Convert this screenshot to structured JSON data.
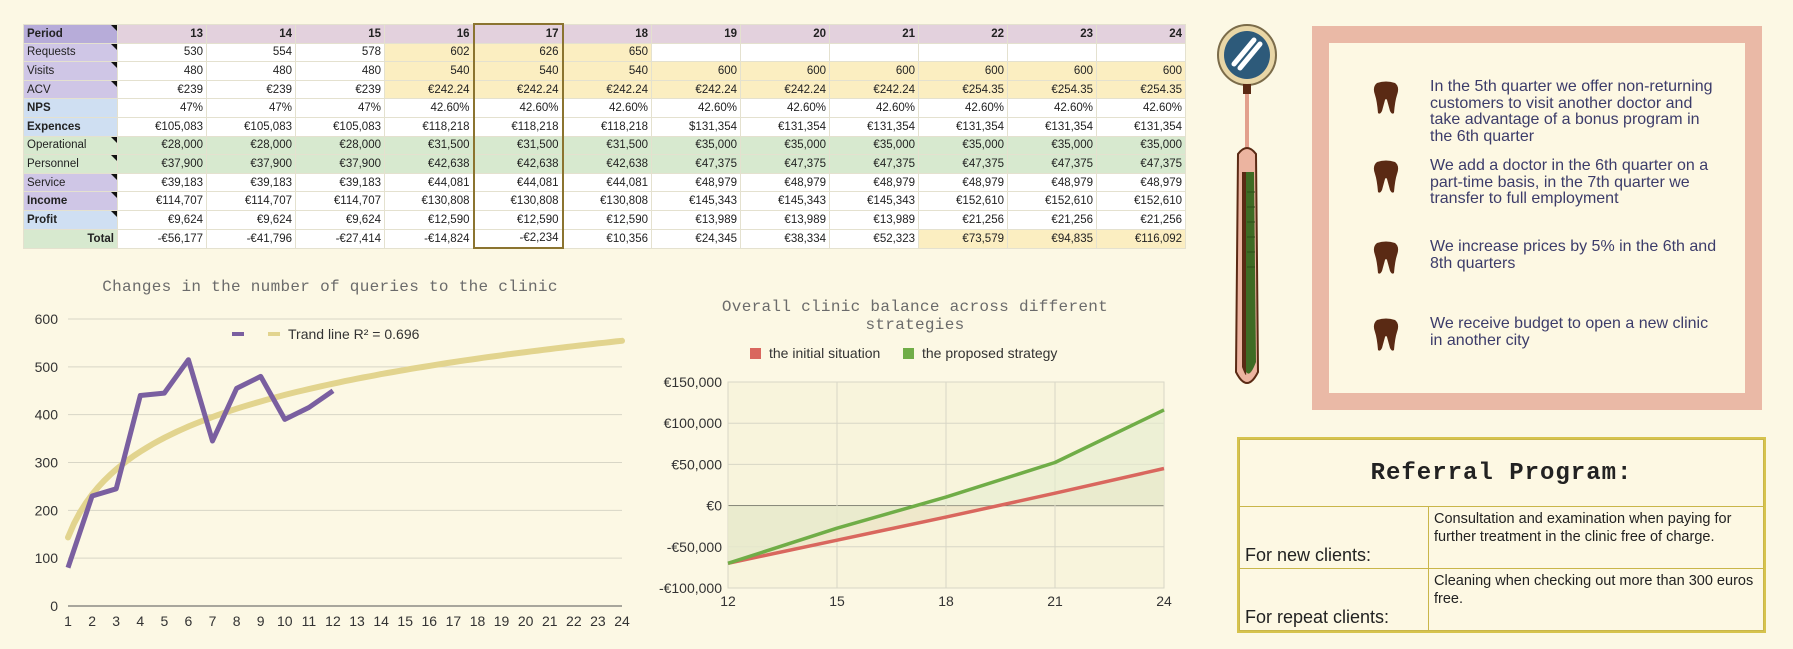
{
  "sheet": {
    "header": [
      "Period",
      "13",
      "14",
      "15",
      "16",
      "17",
      "18",
      "19",
      "20",
      "21",
      "22",
      "23",
      "24"
    ],
    "rows": [
      {
        "label": "Requests",
        "bold": false,
        "band": "purple",
        "cells": [
          "530",
          "554",
          "578",
          "602",
          "626",
          "650",
          "",
          "",
          "",
          "",
          "",
          ""
        ]
      },
      {
        "label": "Visits",
        "bold": false,
        "band": "purple",
        "cells": [
          "480",
          "480",
          "480",
          "540",
          "540",
          "540",
          "600",
          "600",
          "600",
          "600",
          "600",
          "600"
        ]
      },
      {
        "label": "ACV",
        "bold": false,
        "band": "purple",
        "cells": [
          "€239",
          "€239",
          "€239",
          "€242.24",
          "€242.24",
          "€242.24",
          "€242.24",
          "€242.24",
          "€242.24",
          "€254.35",
          "€254.35",
          "€254.35"
        ]
      },
      {
        "label": "NPS",
        "bold": true,
        "band": "blue",
        "cells": [
          "47%",
          "47%",
          "47%",
          "42.60%",
          "42.60%",
          "42.60%",
          "42.60%",
          "42.60%",
          "42.60%",
          "42.60%",
          "42.60%",
          "42.60%"
        ]
      },
      {
        "label": "Expences",
        "bold": true,
        "band": "blue",
        "cells": [
          "€105,083",
          "€105,083",
          "€105,083",
          "€118,218",
          "€118,218",
          "€118,218",
          "$131,354",
          "€131,354",
          "€131,354",
          "€131,354",
          "€131,354",
          "€131,354"
        ]
      },
      {
        "label": "Operational",
        "bold": false,
        "band": "green",
        "cells": [
          "€28,000",
          "€28,000",
          "€28,000",
          "€31,500",
          "€31,500",
          "€31,500",
          "€35,000",
          "€35,000",
          "€35,000",
          "€35,000",
          "€35,000",
          "€35,000"
        ]
      },
      {
        "label": "Personnel",
        "bold": false,
        "band": "green",
        "cells": [
          "€37,900",
          "€37,900",
          "€37,900",
          "€42,638",
          "€42,638",
          "€42,638",
          "€47,375",
          "€47,375",
          "€47,375",
          "€47,375",
          "€47,375",
          "€47,375"
        ]
      },
      {
        "label": "Service",
        "bold": false,
        "band": "purple",
        "cells": [
          "€39,183",
          "€39,183",
          "€39,183",
          "€44,081",
          "€44,081",
          "€44,081",
          "€48,979",
          "€48,979",
          "€48,979",
          "€48,979",
          "€48,979",
          "€48,979"
        ]
      },
      {
        "label": "Income",
        "bold": true,
        "band": "purple",
        "cells": [
          "€114,707",
          "€114,707",
          "€114,707",
          "€130,808",
          "€130,808",
          "€130,808",
          "€145,343",
          "€145,343",
          "€145,343",
          "€152,610",
          "€152,610",
          "€152,610"
        ]
      },
      {
        "label": "Profit",
        "bold": true,
        "band": "blue",
        "cells": [
          "€9,624",
          "€9,624",
          "€9,624",
          "€12,590",
          "€12,590",
          "€12,590",
          "€13,989",
          "€13,989",
          "€13,989",
          "€21,256",
          "€21,256",
          "€21,256"
        ]
      },
      {
        "label": "Total",
        "bold": false,
        "band": "green",
        "cells": [
          "-€56,177",
          "-€41,796",
          "-€27,414",
          "-€14,824",
          "-€2,234",
          "€10,356",
          "€24,345",
          "€38,334",
          "€52,323",
          "€73,579",
          "€94,835",
          "€116,092"
        ]
      }
    ],
    "colors": {
      "purple": "#cfc6e6",
      "blue": "#cfdff2",
      "green": "#d7e9cf",
      "header": "#e3d1dd",
      "header_label": "#b7acd9",
      "highlight": "#fbeec1"
    }
  },
  "chart_data": [
    {
      "type": "line",
      "title": "Changes in the number of queries to the clinic",
      "x": [
        1,
        2,
        3,
        4,
        5,
        6,
        7,
        8,
        9,
        10,
        11,
        12
      ],
      "series": [
        {
          "name": "",
          "color": "#7a5fa0",
          "values": [
            80,
            230,
            245,
            440,
            445,
            515,
            345,
            455,
            480,
            390,
            415,
            450
          ]
        },
        {
          "name": "Trand line R² = 0.696",
          "color": "#e2d48e",
          "trend": "logarithmic",
          "trend_a": 129.3,
          "trend_b": 143.5
        }
      ],
      "xlim": [
        1,
        24
      ],
      "ylim": [
        0,
        600
      ],
      "yticks": [
        0,
        100,
        200,
        300,
        400,
        500,
        600
      ],
      "xticks": [
        1,
        2,
        3,
        4,
        5,
        6,
        7,
        8,
        9,
        10,
        11,
        12,
        13,
        14,
        15,
        16,
        17,
        18,
        19,
        20,
        21,
        22,
        23,
        24
      ],
      "grid": true,
      "legend": "top-center"
    },
    {
      "type": "area",
      "title": "Overall clinic balance across different strategies",
      "x": [
        12,
        15,
        18,
        21,
        24
      ],
      "series": [
        {
          "name": "the initial situation",
          "color": "#d9675e",
          "values": [
            -70000,
            -42000,
            -14000,
            15000,
            45000
          ]
        },
        {
          "name": "the proposed strategy",
          "color": "#70ad47",
          "values": [
            -70000,
            -27414,
            10356,
            52323,
            116092
          ]
        }
      ],
      "xlim": [
        12,
        24
      ],
      "ylim": [
        -100000,
        150000
      ],
      "yticks": [
        "-€100,000",
        "-€50,000",
        "€0",
        "€50,000",
        "€100,000",
        "€150,000"
      ],
      "ytick_values": [
        -100000,
        -50000,
        0,
        50000,
        100000,
        150000
      ],
      "xticks": [
        12,
        15,
        18,
        21,
        24
      ],
      "grid": true,
      "legend": "top-center"
    }
  ],
  "info": {
    "items": [
      {
        "icon": "tooth-icon",
        "text": "In the 5th quarter we offer non-returning customers to visit another doctor and take advantage of a bonus program in the 6th quarter"
      },
      {
        "icon": "tooth-icon",
        "text": "We add a doctor in the 6th quarter on a part-time basis, in the 7th quarter we transfer to full employment"
      },
      {
        "icon": "tooth-icon",
        "text": "We increase prices by 5% in the 6th and 8th quarters"
      },
      {
        "icon": "tooth-icon",
        "text": "We receive budget to open a new clinic in another city"
      }
    ],
    "colors": {
      "frame": "#eab9a6",
      "tooth": "#5a2a14",
      "text": "#3c3c6a"
    }
  },
  "referral": {
    "title": "Referral Program:",
    "rows": [
      {
        "label": "For new clients:",
        "text": "Consultation and examination when paying for further treatment in the clinic free of charge."
      },
      {
        "label": "For repeat clients:",
        "text": "Cleaning when checking out more than 300 euros free."
      }
    ]
  },
  "decor": {
    "icon": "dental-mirror-icon"
  }
}
